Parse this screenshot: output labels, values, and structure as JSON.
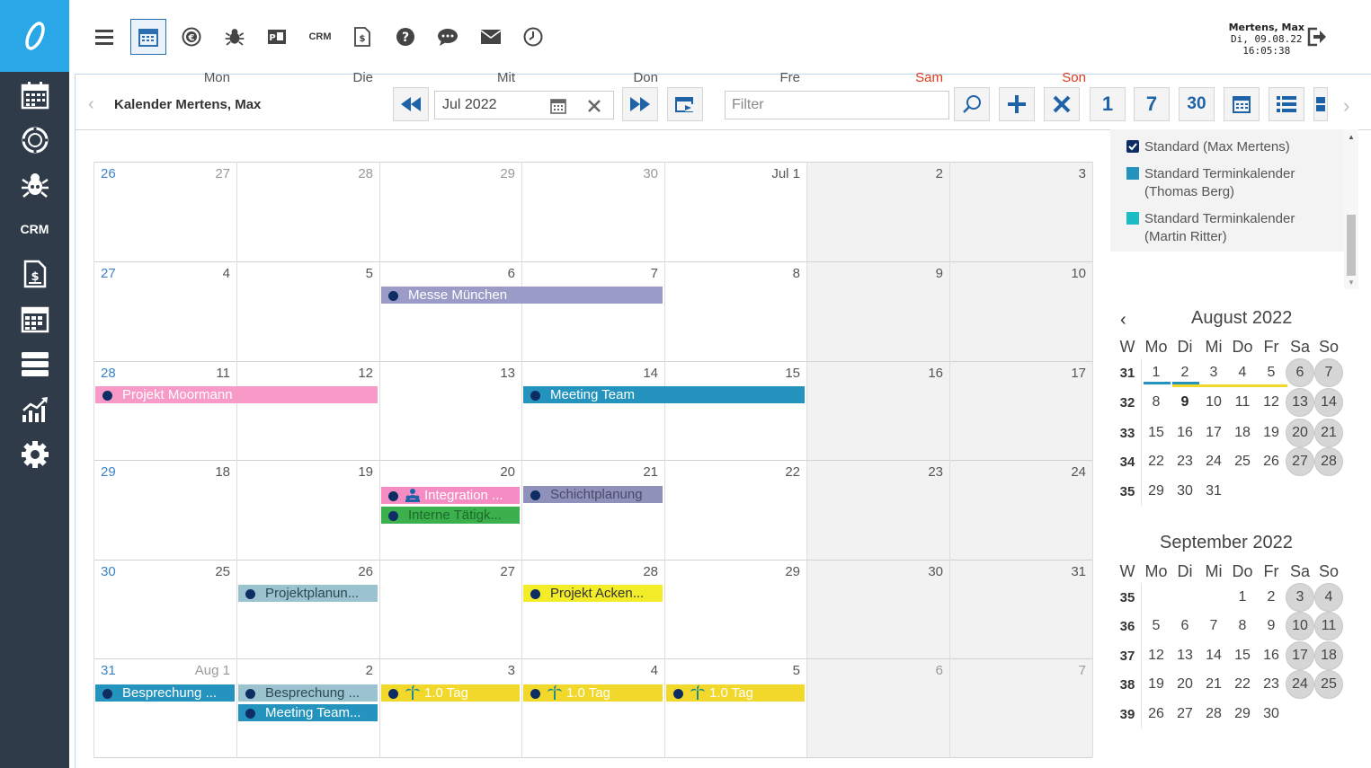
{
  "sidebar": {
    "crm_label": "CRM"
  },
  "topbar": {
    "crm_label": "CRM",
    "user_name": "Mertens, Max",
    "user_date": "Di, 09.08.22",
    "user_time": "16:05:38"
  },
  "toolbar": {
    "title": "Kalender Mertens, Max",
    "date_value": "Jul 2022",
    "filter_placeholder": "Filter",
    "day_btn": "1",
    "week_btn": "7",
    "month_btn": "30"
  },
  "calendar": {
    "day_headers": [
      "Mon",
      "Die",
      "Mit",
      "Don",
      "Fre",
      "Sam",
      "Son"
    ],
    "weekend_color": "#e03a1e",
    "weeks": [
      {
        "wk": "26",
        "days": [
          "27",
          "28",
          "29",
          "30",
          "Jul 1",
          "2",
          "3"
        ]
      },
      {
        "wk": "27",
        "days": [
          "4",
          "5",
          "6",
          "7",
          "8",
          "9",
          "10"
        ]
      },
      {
        "wk": "28",
        "days": [
          "11",
          "12",
          "13",
          "14",
          "15",
          "16",
          "17"
        ]
      },
      {
        "wk": "29",
        "days": [
          "18",
          "19",
          "20",
          "21",
          "22",
          "23",
          "24"
        ]
      },
      {
        "wk": "30",
        "days": [
          "25",
          "26",
          "27",
          "28",
          "29",
          "30",
          "31"
        ]
      },
      {
        "wk": "31",
        "days": [
          "Aug 1",
          "2",
          "3",
          "4",
          "5",
          "6",
          "7"
        ]
      }
    ],
    "events": [
      {
        "label": "Messe München",
        "color": "#9b9bc8"
      },
      {
        "label": "Projekt Moormann",
        "color": "#f79ac8"
      },
      {
        "label": "Meeting Team",
        "color": "#2494bf"
      },
      {
        "label": "Integration ...",
        "color": "#f58cc4"
      },
      {
        "label": "Interne Tätigk...",
        "color": "#3bb04c"
      },
      {
        "label": "Schichtplanung",
        "color": "#8f91bb"
      },
      {
        "label": "Projektplanun...",
        "color": "#9bc3cf"
      },
      {
        "label": "Projekt Acken...",
        "color": "#f2ec29"
      },
      {
        "label": "Besprechung ...",
        "color": "#2494bf"
      },
      {
        "label": "Besprechung ...",
        "color": "#9bc3cf"
      },
      {
        "label": "Meeting Team...",
        "color": "#2494bf"
      },
      {
        "label": "1.0 Tag",
        "color": "#f3d82c"
      },
      {
        "label": "1.0 Tag",
        "color": "#f3d82c"
      },
      {
        "label": "1.0 Tag",
        "color": "#f3d82c"
      }
    ]
  },
  "legend": [
    {
      "label": "Standard (Max Mertens)",
      "color": "#0e2e63"
    },
    {
      "label": "Standard Terminkalender (Thomas Berg)",
      "color": "#2494bf"
    },
    {
      "label": "Standard Terminkalender (Martin Ritter)",
      "color": "#1bbcc4"
    }
  ],
  "mini_aug": {
    "title": "August 2022",
    "headers": [
      "W",
      "Mo",
      "Di",
      "Mi",
      "Do",
      "Fr",
      "Sa",
      "So"
    ],
    "rows": [
      [
        "31",
        "1",
        "2",
        "3",
        "4",
        "5",
        "6",
        "7"
      ],
      [
        "32",
        "8",
        "9",
        "10",
        "11",
        "12",
        "13",
        "14"
      ],
      [
        "33",
        "15",
        "16",
        "17",
        "18",
        "19",
        "20",
        "21"
      ],
      [
        "34",
        "22",
        "23",
        "24",
        "25",
        "26",
        "27",
        "28"
      ],
      [
        "35",
        "29",
        "30",
        "31",
        "",
        "",
        "",
        ""
      ]
    ]
  },
  "mini_sep": {
    "title": "September 2022",
    "headers": [
      "W",
      "Mo",
      "Di",
      "Mi",
      "Do",
      "Fr",
      "Sa",
      "So"
    ],
    "rows": [
      [
        "35",
        "",
        "",
        "",
        "1",
        "2",
        "3",
        "4"
      ],
      [
        "36",
        "5",
        "6",
        "7",
        "8",
        "9",
        "10",
        "11"
      ],
      [
        "37",
        "12",
        "13",
        "14",
        "15",
        "16",
        "17",
        "18"
      ],
      [
        "38",
        "19",
        "20",
        "21",
        "22",
        "23",
        "24",
        "25"
      ],
      [
        "39",
        "26",
        "27",
        "28",
        "29",
        "30",
        "",
        ""
      ]
    ]
  }
}
